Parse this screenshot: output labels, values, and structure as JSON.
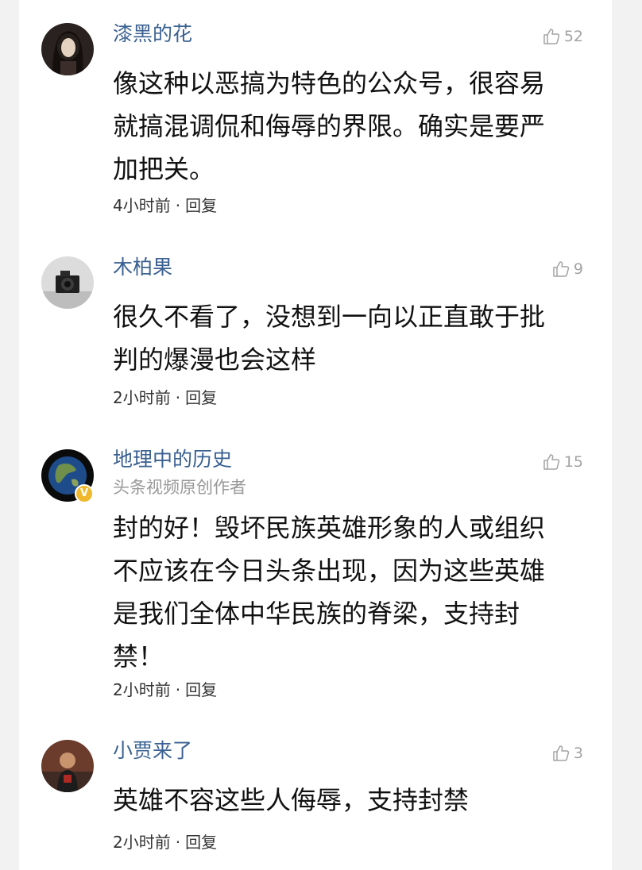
{
  "comments": [
    {
      "username": "漆黑的花",
      "subtitle": "",
      "likes": "52",
      "text": "像这种以恶搞为特色的公众号，很容易\n就搞混调侃和侮辱的界限。确实是要严\n加把关。",
      "time": "4小时前",
      "separator": "·",
      "reply": "回复",
      "verified": false
    },
    {
      "username": "木柏果",
      "subtitle": "",
      "likes": "9",
      "text": "很久不看了，没想到一向以正直敢于批\n判的爆漫也会这样",
      "time": "2小时前",
      "separator": "·",
      "reply": "回复",
      "verified": false
    },
    {
      "username": "地理中的历史",
      "subtitle": "头条视频原创作者",
      "likes": "15",
      "text": "封的好！毁坏民族英雄形象的人或组织\n不应该在今日头条出现，因为这些英雄\n是我们全体中华民族的脊梁，支持封\n禁！",
      "time": "2小时前",
      "separator": "·",
      "reply": "回复",
      "verified": true,
      "badge": "V"
    },
    {
      "username": "小贾来了",
      "subtitle": "",
      "likes": "3",
      "text": "英雄不容这些人侮辱，支持封禁",
      "time": "2小时前",
      "separator": "·",
      "reply": "回复",
      "verified": false
    }
  ],
  "colors": {
    "username": "#3a6192",
    "muted": "#a3a3a3",
    "text": "#111111",
    "badge": "#f0b92d"
  }
}
